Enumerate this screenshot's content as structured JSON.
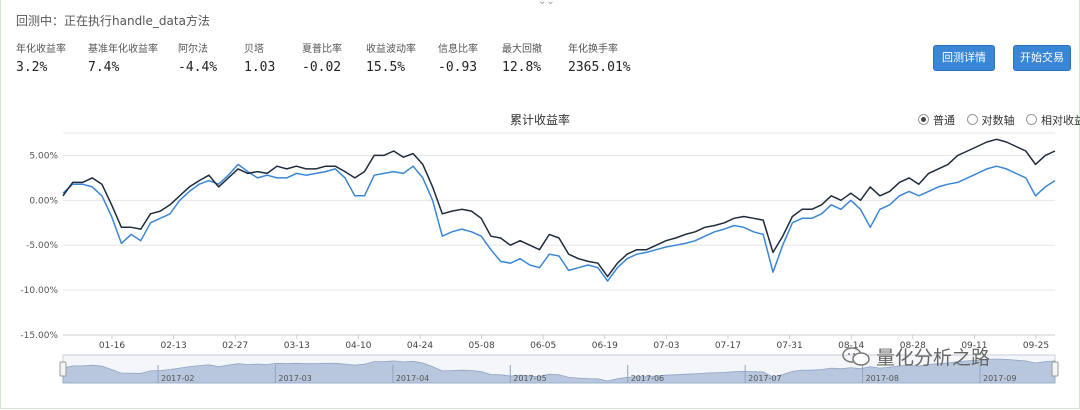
{
  "top_handle": "⌄⌄",
  "status_text": "回测中：正在执行handle_data方法",
  "metrics": [
    {
      "label": "年化收益率",
      "value": "3.2%"
    },
    {
      "label": "基准年化收益率",
      "value": "7.4%"
    },
    {
      "label": "阿尔法",
      "value": "-4.4%"
    },
    {
      "label": "贝塔",
      "value": "1.03"
    },
    {
      "label": "夏普比率",
      "value": "-0.02"
    },
    {
      "label": "收益波动率",
      "value": "15.5%"
    },
    {
      "label": "信息比率",
      "value": "-0.93"
    },
    {
      "label": "最大回撤",
      "value": "12.8%"
    },
    {
      "label": "年化换手率",
      "value": "2365.01%"
    }
  ],
  "buttons": {
    "details": "回测详情",
    "trade": "开始交易"
  },
  "chart": {
    "title": "累计收益率",
    "legend": {
      "normal": "普通",
      "log": "对数轴",
      "relative": "相对收益",
      "selected": "normal"
    }
  },
  "watermark": "量化分析之路",
  "colors": {
    "benchmark": "#1e2b3c",
    "strategy": "#3a86d6",
    "navigator": "#b8c7dd",
    "button": "#3a86d6"
  },
  "chart_data": {
    "type": "line",
    "title": "累计收益率",
    "ylim": [
      -15,
      7.5
    ],
    "y_ticks": [
      5,
      0,
      -5,
      -10,
      -15
    ],
    "y_tick_labels": [
      "5.00%",
      "0.00%",
      "-5.00%",
      "-10.00%",
      "-15.00%"
    ],
    "x_tick_labels": [
      "01-16",
      "02-13",
      "02-27",
      "03-13",
      "04-10",
      "04-24",
      "05-08",
      "06-05",
      "06-19",
      "07-03",
      "07-17",
      "07-31",
      "08-14",
      "08-28",
      "09-11",
      "09-25"
    ],
    "navigator_labels": [
      "2017-02",
      "2017-03",
      "2017-04",
      "2017-05",
      "2017-06",
      "2017-07",
      "2017-08",
      "2017-09"
    ],
    "series": [
      {
        "values": [
          0.5,
          2.0,
          2.0,
          2.5,
          1.8,
          -0.5,
          -3.0,
          -3.0,
          -3.2,
          -1.5,
          -1.2,
          -0.5,
          0.5,
          1.5,
          2.2,
          2.8,
          1.5,
          2.5,
          3.5,
          3.0,
          3.2,
          3.0,
          3.8,
          3.5,
          3.8,
          3.5,
          3.5,
          3.8,
          3.8,
          3.2,
          2.5,
          3.2,
          5.0,
          5.0,
          5.5,
          4.8,
          5.2,
          4.0,
          1.5,
          -1.5,
          -1.2,
          -1.0,
          -1.2,
          -2.0,
          -4.0,
          -4.2,
          -5.0,
          -4.5,
          -5.0,
          -5.5,
          -3.8,
          -4.2,
          -6.0,
          -6.5,
          -6.8,
          -7.0,
          -8.5,
          -7.0,
          -6.0,
          -5.5,
          -5.5,
          -5.0,
          -4.5,
          -4.2,
          -3.8,
          -3.5,
          -3.0,
          -2.8,
          -2.5,
          -2.0,
          -1.8,
          -2.0,
          -2.2,
          -5.8,
          -4.0,
          -1.8,
          -1.0,
          -1.0,
          -0.5,
          0.5,
          0.0,
          0.8,
          0.0,
          1.5,
          0.5,
          1.0,
          2.0,
          2.5,
          1.8,
          3.0,
          3.5,
          4.0,
          5.0,
          5.5,
          6.0,
          6.5,
          6.8,
          6.5,
          6.0,
          5.5,
          4.0,
          5.0,
          5.5
        ]
      },
      {
        "values": [
          0.8,
          1.8,
          1.8,
          1.5,
          0.5,
          -1.8,
          -4.8,
          -3.8,
          -4.5,
          -2.5,
          -2.0,
          -1.5,
          0.0,
          1.0,
          1.8,
          2.2,
          1.8,
          2.8,
          4.0,
          3.2,
          2.5,
          2.8,
          2.5,
          2.5,
          3.0,
          2.8,
          3.0,
          3.2,
          3.5,
          2.5,
          0.5,
          0.5,
          2.8,
          3.0,
          3.2,
          3.0,
          3.8,
          2.5,
          0.0,
          -4.0,
          -3.5,
          -3.2,
          -3.5,
          -4.0,
          -5.5,
          -6.8,
          -7.0,
          -6.5,
          -7.2,
          -7.5,
          -6.0,
          -6.2,
          -7.8,
          -7.5,
          -7.2,
          -7.5,
          -9.0,
          -7.5,
          -6.5,
          -6.0,
          -5.8,
          -5.5,
          -5.2,
          -5.0,
          -4.8,
          -4.5,
          -4.0,
          -3.5,
          -3.2,
          -2.8,
          -3.0,
          -3.5,
          -3.8,
          -8.0,
          -5.0,
          -2.5,
          -2.0,
          -2.0,
          -1.5,
          -0.5,
          -1.0,
          0.0,
          -1.0,
          -3.0,
          -1.0,
          -0.5,
          0.5,
          1.0,
          0.5,
          1.0,
          1.5,
          1.8,
          2.0,
          2.5,
          3.0,
          3.5,
          3.8,
          3.5,
          3.0,
          2.5,
          0.5,
          1.5,
          2.2
        ]
      }
    ]
  }
}
